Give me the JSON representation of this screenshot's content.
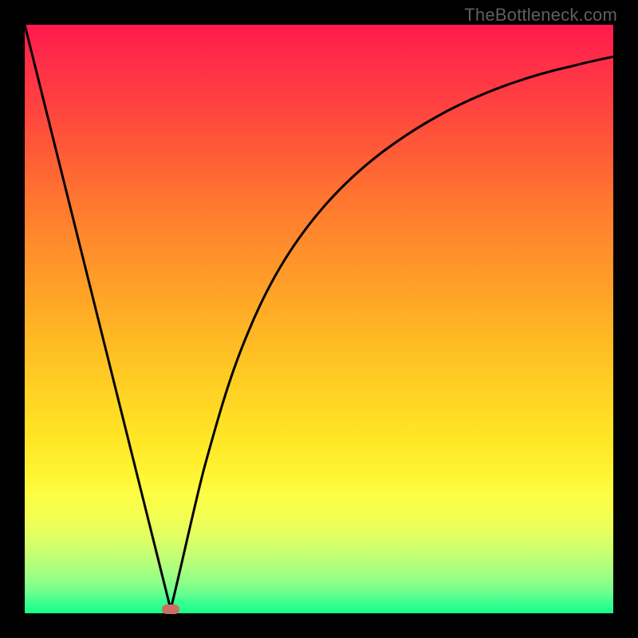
{
  "attribution": "TheBottleneck.com",
  "marker": {
    "x_frac": 0.248,
    "y_frac": 0.993
  },
  "colors": {
    "curve": "#000000",
    "marker": "#cc6e63"
  },
  "chart_data": {
    "type": "line",
    "title": "",
    "xlabel": "",
    "ylabel": "",
    "xlim": [
      0,
      1
    ],
    "ylim": [
      0,
      1
    ],
    "note": "y is plotted with origin at bottom; higher y = higher on image",
    "series": [
      {
        "name": "bottleneck-curve",
        "x": [
          0.0,
          0.05,
          0.1,
          0.15,
          0.2,
          0.248,
          0.28,
          0.305,
          0.33,
          0.36,
          0.4,
          0.45,
          0.51,
          0.58,
          0.66,
          0.75,
          0.85,
          0.93,
          1.0
        ],
        "y": [
          1.0,
          0.8,
          0.6,
          0.4,
          0.2,
          0.007,
          0.134,
          0.246,
          0.34,
          0.43,
          0.52,
          0.607,
          0.68,
          0.742,
          0.793,
          0.833,
          0.865,
          0.884,
          0.896
        ]
      }
    ],
    "marker_point": {
      "x": 0.248,
      "y": 0.007
    }
  }
}
